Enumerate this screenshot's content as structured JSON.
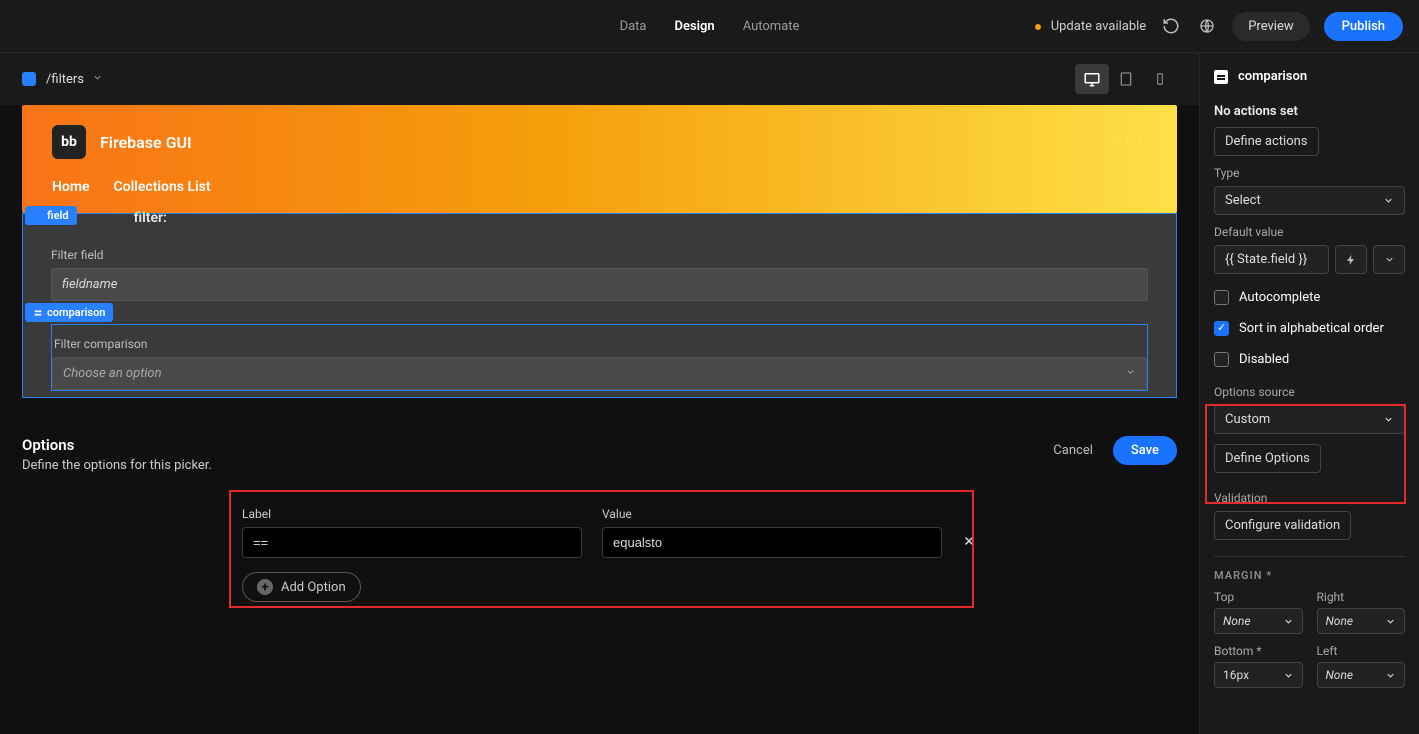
{
  "topbar": {
    "tabs": {
      "data": "Data",
      "design": "Design",
      "automate": "Automate"
    },
    "update": "Update available",
    "preview": "Preview",
    "publish": "Publish"
  },
  "breadcrumb": {
    "path": "/filters"
  },
  "app": {
    "logo": "bb",
    "title": "Firebase GUI",
    "nav": {
      "home": "Home",
      "collections": "Collections List"
    }
  },
  "filter": {
    "tag_field": "field",
    "title": "filter:",
    "field_label": "Filter field",
    "field_value": "fieldname",
    "tag_comparison": "comparison",
    "comparison_label": "Filter comparison",
    "comparison_placeholder": "Choose an option"
  },
  "options_modal": {
    "title": "Options",
    "subtitle": "Define the options for this picker.",
    "cancel": "Cancel",
    "save": "Save",
    "label_header": "Label",
    "value_header": "Value",
    "row1": {
      "label": "==",
      "value": "equalsto"
    },
    "add_option": "Add Option"
  },
  "sidebar": {
    "component_name": "comparison",
    "no_actions": "No actions set",
    "define_actions": "Define actions",
    "type_label": "Type",
    "type_value": "Select",
    "default_label": "Default value",
    "default_value": "{{ State.field }}",
    "autocomplete": "Autocomplete",
    "sort_alpha": "Sort in alphabetical order",
    "disabled": "Disabled",
    "options_source_label": "Options source",
    "options_source_value": "Custom",
    "define_options": "Define Options",
    "validation_label": "Validation",
    "configure_validation": "Configure validation",
    "margin_title": "MARGIN *",
    "margin": {
      "top_label": "Top",
      "top_val": "None",
      "right_label": "Right",
      "right_val": "None",
      "bottom_label": "Bottom *",
      "bottom_val": "16px",
      "left_label": "Left",
      "left_val": "None"
    }
  }
}
